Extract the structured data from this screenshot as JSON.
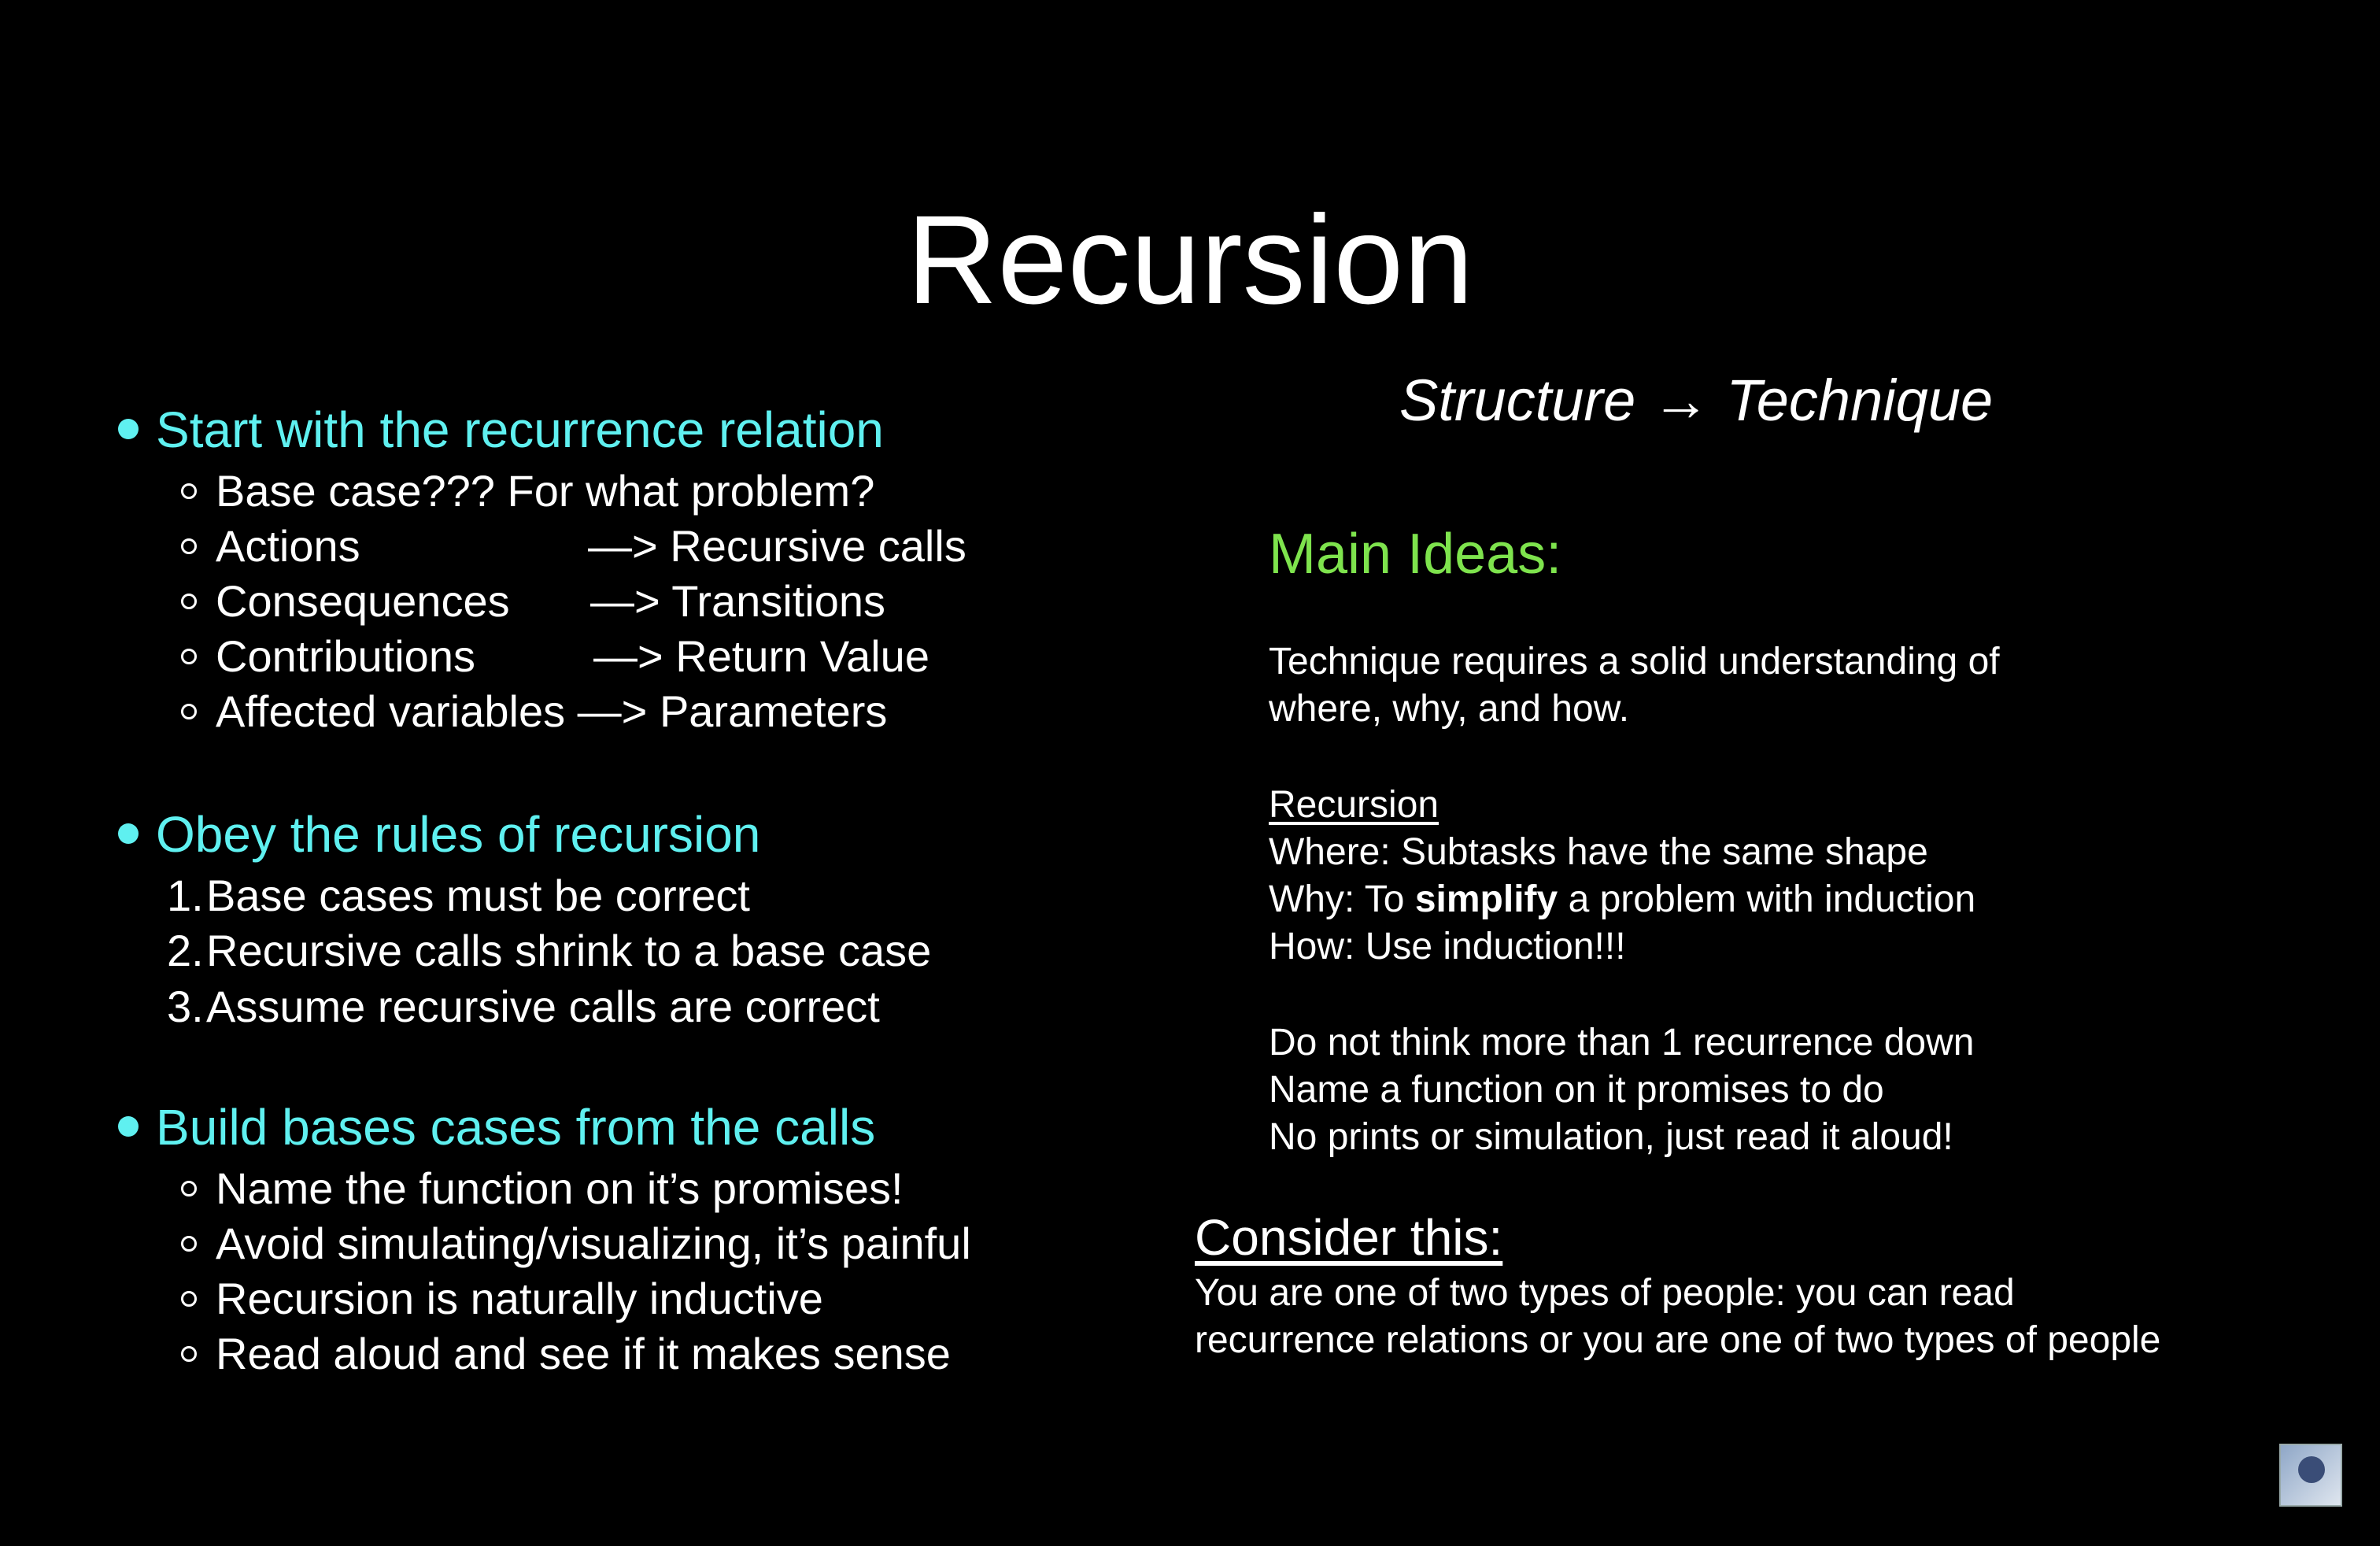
{
  "title": "Recursion",
  "left": {
    "sections": [
      {
        "heading": "Start with the recurrence relation",
        "items": [
          {
            "left": "Base case??? For what problem?",
            "right": ""
          },
          {
            "left": "Actions",
            "right": "—> Recursive calls"
          },
          {
            "left": "Consequences",
            "right": "—> Transitions"
          },
          {
            "left": "Contributions",
            "right": "—> Return Value"
          },
          {
            "left": "Affected variables —> Parameters",
            "right": ""
          }
        ]
      },
      {
        "heading": "Obey the rules of recursion",
        "items": [
          {
            "num": "1.",
            "text": "Base cases must be correct"
          },
          {
            "num": "2.",
            "text": "Recursive calls shrink to a base case"
          },
          {
            "num": "3.",
            "text": "Assume recursive calls are correct"
          }
        ]
      },
      {
        "heading": "Build bases cases from the calls",
        "items": [
          {
            "text": "Name the function on it’s promises!"
          },
          {
            "text": "Avoid simulating/visualizing, it’s painful"
          },
          {
            "text": "Recursion is naturally inductive"
          },
          {
            "text": "Read aloud and see if it makes sense"
          }
        ]
      }
    ]
  },
  "right": {
    "subtitle": "Structure → Technique",
    "main_ideas_heading": "Main Ideas:",
    "paragraph1": [
      "Technique requires a solid understanding of",
      "where, why, and how."
    ],
    "recursion_heading": "Recursion",
    "where_line": "Where: Subtasks have the same shape",
    "why_prefix": "Why: To ",
    "why_bold": "simplify",
    "why_suffix": " a problem with induction",
    "how_line": "How: Use induction!!!",
    "paragraph3": [
      "Do not think more than 1 recurrence down",
      "Name a function on it promises to do",
      "No prints or simulation, just read it aloud!"
    ],
    "consider_heading": "Consider this:",
    "consider_body": [
      "You are one of two types of people: you can read",
      "recurrence relations or you are one of two types of people"
    ]
  },
  "colors": {
    "heading": "#5ff0f0",
    "main_ideas": "#7ee34d",
    "background": "#000000"
  },
  "icons": {
    "corner_logo": "logo-icon"
  }
}
